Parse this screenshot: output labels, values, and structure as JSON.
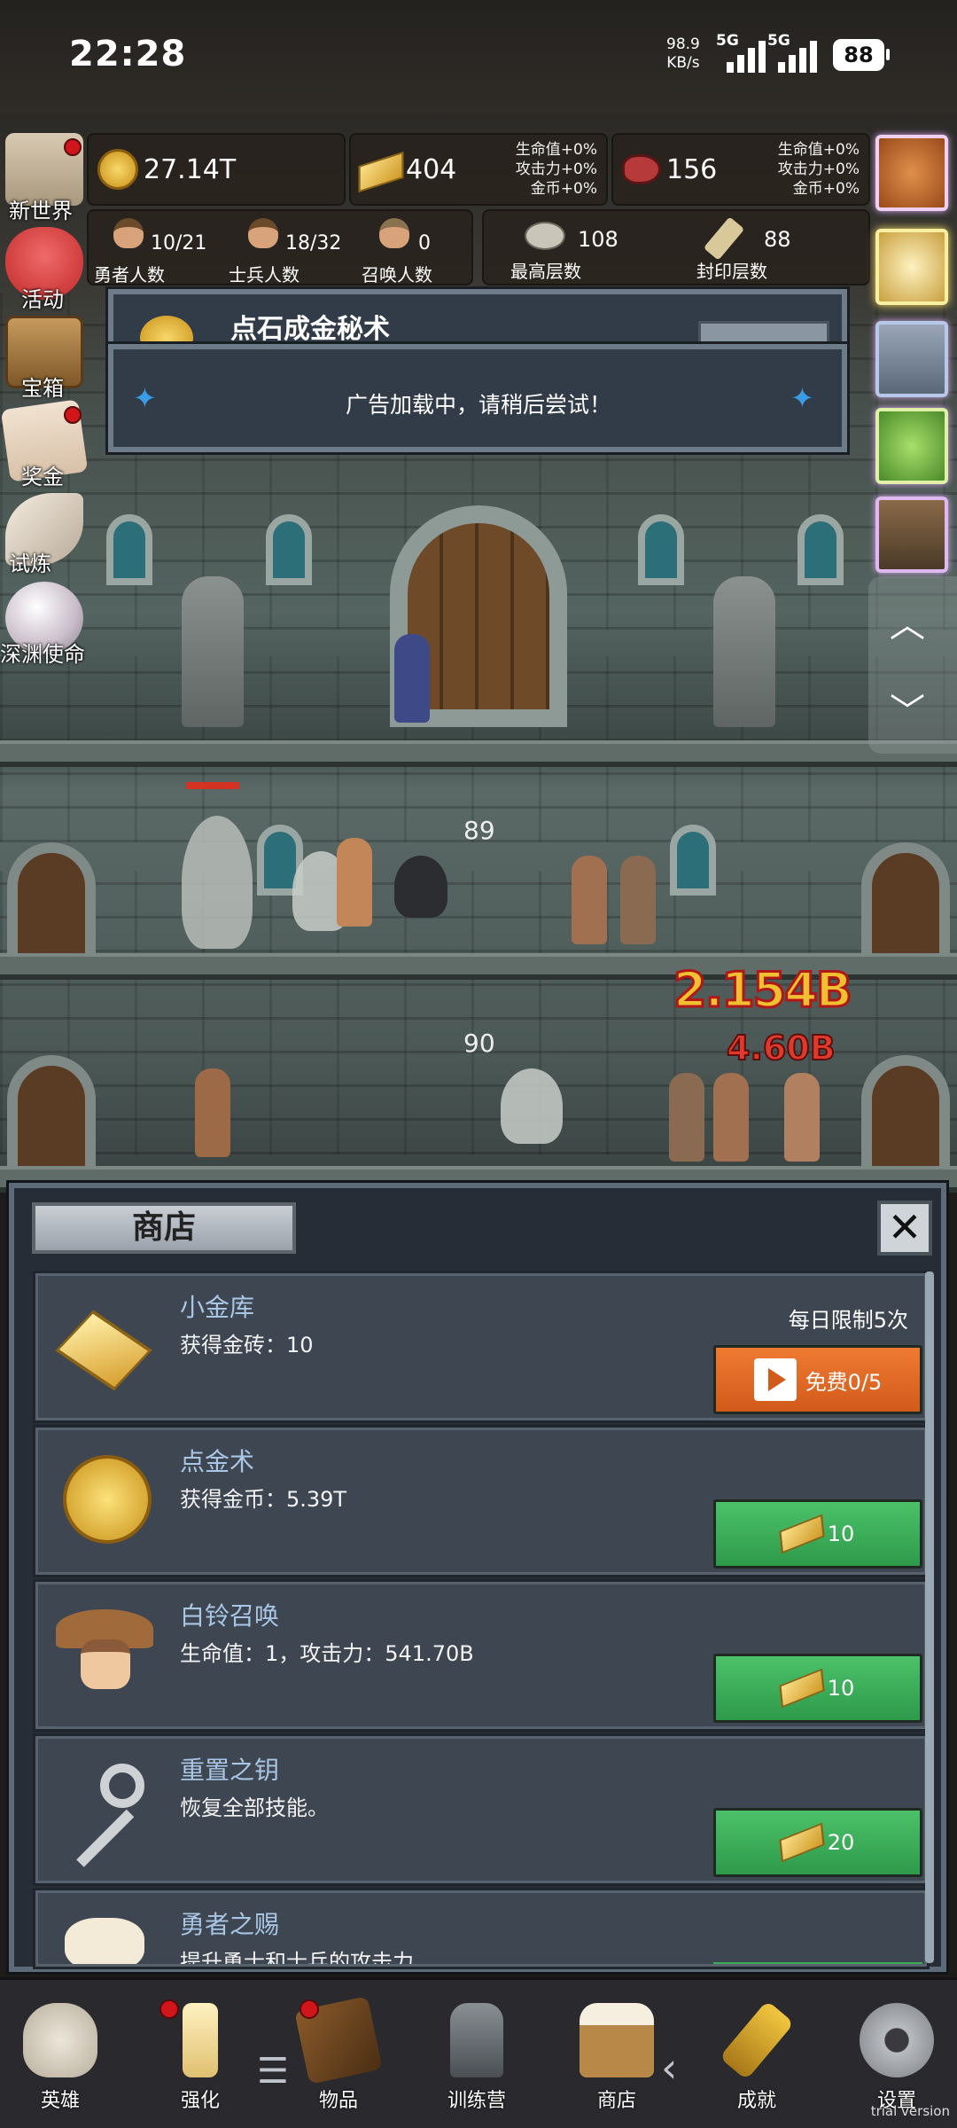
{
  "status_bar": {
    "time": "22:28",
    "net_speed": "98.9",
    "net_unit": "KB/s",
    "sig1": "5G",
    "sig2": "5G",
    "battery": "88"
  },
  "resources": {
    "coins": "27.14T",
    "gold_bars": "404",
    "gold_bars_bonus": [
      "生命值+0%",
      "攻击力+0%",
      "金币+0%"
    ],
    "meat": "156",
    "meat_bonus": [
      "生命值+0%",
      "攻击力+0%",
      "金币+0%"
    ]
  },
  "counts": {
    "heroes_val": "10/21",
    "heroes_label": "勇者人数",
    "soldiers_val": "18/32",
    "soldiers_label": "士兵人数",
    "summons_val": "0",
    "summons_label": "召唤人数",
    "max_floor_val": "108",
    "max_floor_label": "最高层数",
    "seal_floor_val": "88",
    "seal_floor_label": "封印层数"
  },
  "side_menu": [
    "新世界",
    "活动",
    "宝箱",
    "奖金",
    "试炼",
    "深渊使命"
  ],
  "dialogs": {
    "back_title": "点石成金秘术",
    "ad_message": "广告加载中，请稍后尝试！"
  },
  "scene": {
    "floor_a": "89",
    "floor_b": "90",
    "damage_1": "2.154B",
    "damage_2": "4.60B"
  },
  "shop": {
    "title": "商店",
    "close": "✕",
    "items": [
      {
        "name": "小金库",
        "desc": "获得金砖：10",
        "limit": "每日限制5次",
        "button": "免费0/5",
        "icon": "gold-bar-icon"
      },
      {
        "name": "点金术",
        "desc": "获得金币：5.39T",
        "button": "10",
        "icon": "gold-coin-icon"
      },
      {
        "name": "白铃召唤",
        "desc": "生命值：1，攻击力：541.70B",
        "button": "10",
        "icon": "girl-portrait-icon"
      },
      {
        "name": "重置之钥",
        "desc": "恢复全部技能。",
        "button": "20",
        "icon": "key-icon"
      },
      {
        "name": "勇者之赐",
        "desc": "提升勇士和士兵的攻击力。",
        "icon": "ale-mug-icon"
      }
    ]
  },
  "bottom_nav": [
    "英雄",
    "强化",
    "物品",
    "训练营",
    "商店",
    "成就",
    "设置"
  ],
  "watermark": "trial version",
  "colors": {
    "green_button": "#3aac58",
    "orange_button": "#e06a24",
    "item_name": "#a9c6e4"
  }
}
